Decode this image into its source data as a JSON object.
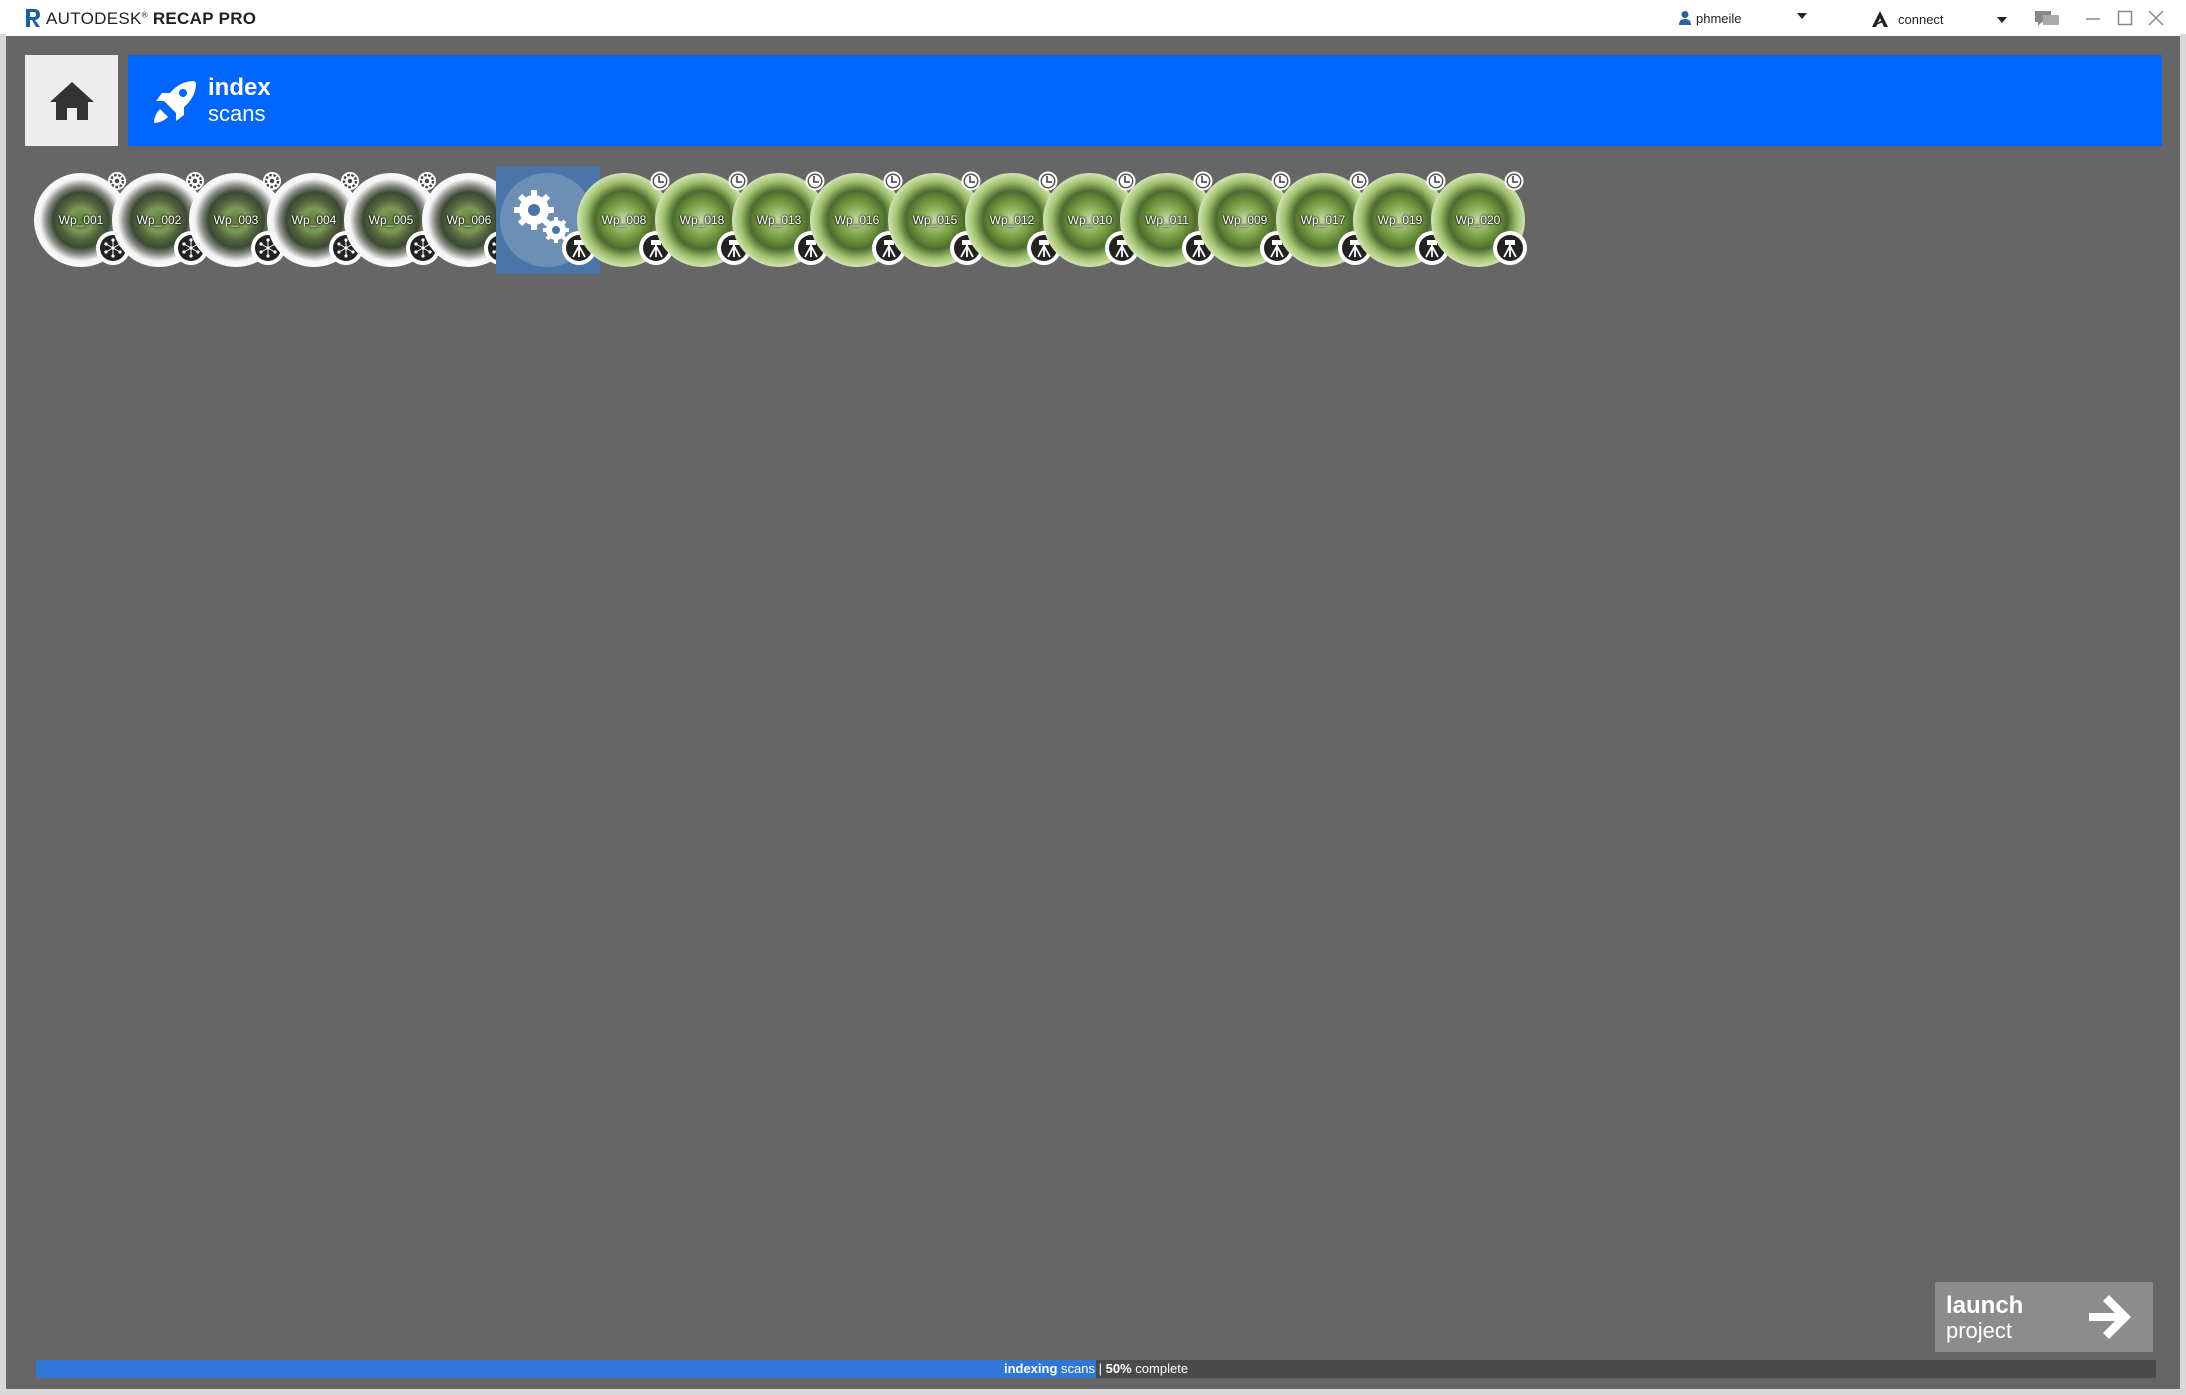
{
  "titlebar": {
    "brand": "AUTODESK",
    "product": "RECAP PRO",
    "user_name": "phmeile",
    "connect_label": "connect"
  },
  "banner": {
    "title": "index",
    "subtitle": "scans",
    "color": "#0066ff"
  },
  "scans": [
    {
      "label": "Wp_001",
      "state": "indexed",
      "status_icon": "gear-icon",
      "type_icon": "network-icon"
    },
    {
      "label": "Wp_002",
      "state": "indexed",
      "status_icon": "gear-icon",
      "type_icon": "network-icon"
    },
    {
      "label": "Wp_003",
      "state": "indexed",
      "status_icon": "gear-icon",
      "type_icon": "network-icon"
    },
    {
      "label": "Wp_004",
      "state": "indexed",
      "status_icon": "gear-icon",
      "type_icon": "network-icon"
    },
    {
      "label": "Wp_005",
      "state": "indexed",
      "status_icon": "gear-icon",
      "type_icon": "network-icon"
    },
    {
      "label": "Wp_006",
      "state": "indexed",
      "status_icon": "gear-icon",
      "type_icon": "network-icon"
    },
    {
      "label": "",
      "state": "processing",
      "status_icon": "gears-icon",
      "type_icon": "tripod-icon"
    },
    {
      "label": "Wp_008",
      "state": "pending",
      "status_icon": "clock-icon",
      "type_icon": "tripod-icon"
    },
    {
      "label": "Wp_018",
      "state": "pending",
      "status_icon": "clock-icon",
      "type_icon": "tripod-icon"
    },
    {
      "label": "Wp_013",
      "state": "pending",
      "status_icon": "clock-icon",
      "type_icon": "tripod-icon"
    },
    {
      "label": "Wp_016",
      "state": "pending",
      "status_icon": "clock-icon",
      "type_icon": "tripod-icon"
    },
    {
      "label": "Wp_015",
      "state": "pending",
      "status_icon": "clock-icon",
      "type_icon": "tripod-icon"
    },
    {
      "label": "Wp_012",
      "state": "pending",
      "status_icon": "clock-icon",
      "type_icon": "tripod-icon"
    },
    {
      "label": "Wp_010",
      "state": "pending",
      "status_icon": "clock-icon",
      "type_icon": "tripod-icon"
    },
    {
      "label": "Wp_011",
      "state": "pending",
      "status_icon": "clock-icon",
      "type_icon": "tripod-icon"
    },
    {
      "label": "Wp_009",
      "state": "pending",
      "status_icon": "clock-icon",
      "type_icon": "tripod-icon"
    },
    {
      "label": "Wp_017",
      "state": "pending",
      "status_icon": "clock-icon",
      "type_icon": "tripod-icon"
    },
    {
      "label": "Wp_019",
      "state": "pending",
      "status_icon": "clock-icon",
      "type_icon": "tripod-icon"
    },
    {
      "label": "Wp_020",
      "state": "pending",
      "status_icon": "clock-icon",
      "type_icon": "tripod-icon"
    }
  ],
  "launch": {
    "line1": "launch",
    "line2": "project"
  },
  "progress": {
    "action_bold": "indexing",
    "action_rest": "scans",
    "separator": "|",
    "percent_label": "50%",
    "suffix": "complete",
    "fraction": 0.5,
    "fill_color": "#2e77d8"
  }
}
